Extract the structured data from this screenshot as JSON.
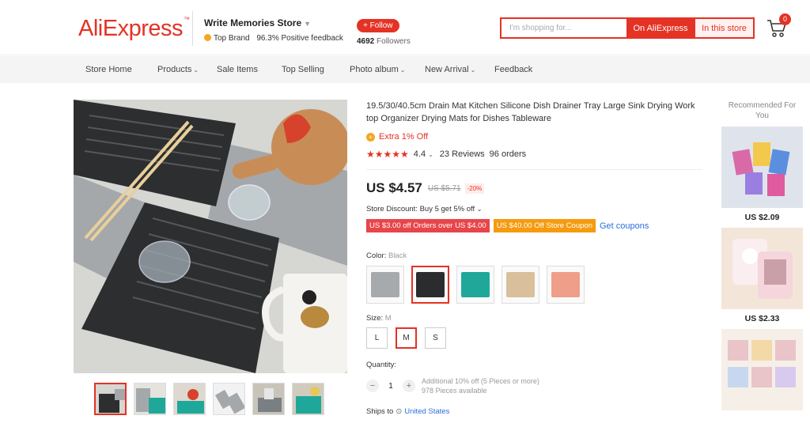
{
  "header": {
    "logo": "AliExpress",
    "store_name": "Write Memories Store",
    "top_brand": "Top Brand",
    "positive_feedback": "96.3% Positive feedback",
    "follow_label": "+ Follow",
    "followers_count": "4692",
    "followers_label": "Followers",
    "search_placeholder": "I'm shopping for...",
    "search_aliexpress": "On AliExpress",
    "search_store": "In this store",
    "cart_count": "0"
  },
  "nav": {
    "items": [
      {
        "label": "Store Home"
      },
      {
        "label": "Products"
      },
      {
        "label": "Sale Items"
      },
      {
        "label": "Top Selling"
      },
      {
        "label": "Photo album"
      },
      {
        "label": "New Arrival"
      },
      {
        "label": "Feedback"
      }
    ]
  },
  "product": {
    "title": "19.5/30/40.5cm Drain Mat Kitchen Silicone Dish Drainer Tray Large Sink Drying Work top Organizer Drying Mats for Dishes Tableware",
    "extra_off": "Extra 1% Off",
    "rating": "4.4",
    "reviews": "23 Reviews",
    "orders": "96 orders",
    "price": "US $4.57",
    "original_price": "US $5.71",
    "discount": "-20%",
    "store_discount": "Store Discount: Buy 5 get 5% off",
    "coupons": [
      "US $3.00 off Orders over US $4.00",
      "US $40.00 Off Store Coupon"
    ],
    "get_coupons": "Get coupons",
    "color_label": "Color:",
    "color_value": "Black",
    "colors": [
      {
        "name": "gray",
        "hex": "#a7aaad"
      },
      {
        "name": "black",
        "hex": "#2a2c2e"
      },
      {
        "name": "teal",
        "hex": "#1fa89a"
      },
      {
        "name": "beige",
        "hex": "#d9bf9c"
      },
      {
        "name": "pink",
        "hex": "#ef9e8a"
      }
    ],
    "selected_color_index": 1,
    "size_label": "Size:",
    "size_value": "M",
    "sizes": [
      "L",
      "M",
      "S"
    ],
    "selected_size": "M",
    "quantity_label": "Quantity:",
    "quantity": "1",
    "quantity_note_1": "Additional 10% off (5 Pieces or more)",
    "quantity_note_2": "978 Pieces available",
    "ships_to_label": "Ships to",
    "ships_to_country": "United States"
  },
  "recommended": {
    "title": "Recommended For You",
    "items": [
      {
        "price": "US $2.09"
      },
      {
        "price": "US $2.33"
      },
      {
        "price": ""
      }
    ]
  },
  "colors": {
    "accent": "#e43225",
    "link": "#2a6fdb",
    "coupon_red": "#e8454a",
    "coupon_orange": "#f59b0f"
  }
}
